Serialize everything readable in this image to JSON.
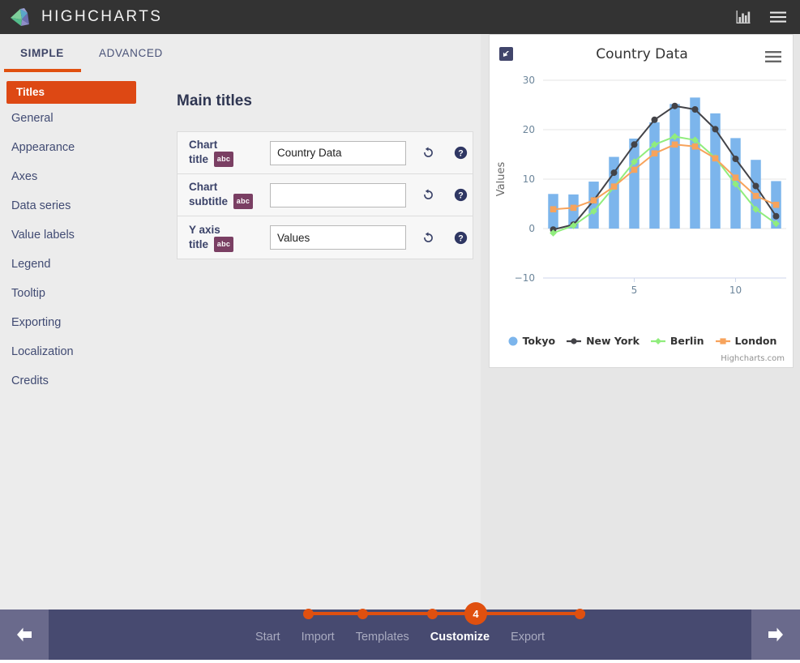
{
  "header": {
    "brand_name": "HIGHCHARTS",
    "logo_icon": "highcharts-logo-icon",
    "actions": [
      {
        "name": "bar-chart-icon",
        "label": "Charts"
      },
      {
        "name": "hamburger-menu-icon",
        "label": "Menu"
      }
    ]
  },
  "tabs": [
    {
      "label": "SIMPLE",
      "active": true
    },
    {
      "label": "ADVANCED",
      "active": false
    }
  ],
  "sidebar": {
    "items": [
      {
        "label": "Titles",
        "selected": true
      },
      {
        "label": "General",
        "selected": false
      },
      {
        "label": "Appearance",
        "selected": false
      },
      {
        "label": "Axes",
        "selected": false
      },
      {
        "label": "Data series",
        "selected": false
      },
      {
        "label": "Value labels",
        "selected": false
      },
      {
        "label": "Legend",
        "selected": false
      },
      {
        "label": "Tooltip",
        "selected": false
      },
      {
        "label": "Exporting",
        "selected": false
      },
      {
        "label": "Localization",
        "selected": false
      },
      {
        "label": "Credits",
        "selected": false
      }
    ]
  },
  "form": {
    "heading": "Main titles",
    "badge_text": "abc",
    "reset_icon": "reset-icon",
    "help_icon": "help-icon",
    "fields": [
      {
        "label_line1": "Chart",
        "label_line2": "title",
        "value": "Country Data",
        "placeholder": ""
      },
      {
        "label_line1": "Chart",
        "label_line2": "subtitle",
        "value": "",
        "placeholder": ""
      },
      {
        "label_line1": "Y axis",
        "label_line2": "title",
        "value": "Values",
        "placeholder": ""
      }
    ]
  },
  "preview": {
    "resize_icon": "resize-handle-icon",
    "menu_icon": "chart-context-menu-icon",
    "credits": "Highcharts.com"
  },
  "chart_data": {
    "type": "line",
    "title": "Country Data",
    "subtitle": "",
    "xlabel": "",
    "ylabel": "Values",
    "ylim": [
      -10,
      30
    ],
    "yticks": [
      -10,
      0,
      10,
      20,
      30
    ],
    "xlim": [
      0.5,
      12.5
    ],
    "x": [
      1,
      2,
      3,
      4,
      5,
      6,
      7,
      8,
      9,
      10,
      11,
      12
    ],
    "xticks": [
      5,
      10
    ],
    "grid": true,
    "legend_position": "bottom",
    "series": [
      {
        "name": "Tokyo",
        "type": "column",
        "color": "#7cb5ec",
        "marker": "circle",
        "values": [
          7.0,
          6.9,
          9.5,
          14.5,
          18.2,
          21.5,
          25.2,
          26.5,
          23.3,
          18.3,
          13.9,
          9.6
        ]
      },
      {
        "name": "New York",
        "type": "line",
        "color": "#434348",
        "marker": "circle",
        "values": [
          -0.2,
          0.8,
          5.7,
          11.3,
          17.0,
          22.0,
          24.8,
          24.1,
          20.1,
          14.1,
          8.6,
          2.5
        ]
      },
      {
        "name": "Berlin",
        "type": "line",
        "color": "#90ed7d",
        "marker": "diamond",
        "values": [
          -0.9,
          0.6,
          3.5,
          8.4,
          13.5,
          17.0,
          18.6,
          17.9,
          14.3,
          9.0,
          3.9,
          1.0
        ]
      },
      {
        "name": "London",
        "type": "line",
        "color": "#f7a35c",
        "marker": "square",
        "values": [
          3.9,
          4.2,
          5.7,
          8.5,
          11.9,
          15.2,
          17.0,
          16.6,
          14.2,
          10.3,
          6.6,
          4.8
        ]
      }
    ]
  },
  "wizard": {
    "prev_icon": "arrow-left-icon",
    "next_icon": "arrow-right-icon",
    "current_step": "4",
    "steps": [
      {
        "label": "Start",
        "active": false
      },
      {
        "label": "Import",
        "active": false
      },
      {
        "label": "Templates",
        "active": false
      },
      {
        "label": "Customize",
        "active": true
      },
      {
        "label": "Export",
        "active": false
      }
    ]
  },
  "colors": {
    "accent": "#e0500f",
    "selected_item": "#dd4814",
    "header_bg": "#333333",
    "wizard_bg": "#474a70",
    "label_text": "#3b4369",
    "badge": "#7a3f63"
  }
}
